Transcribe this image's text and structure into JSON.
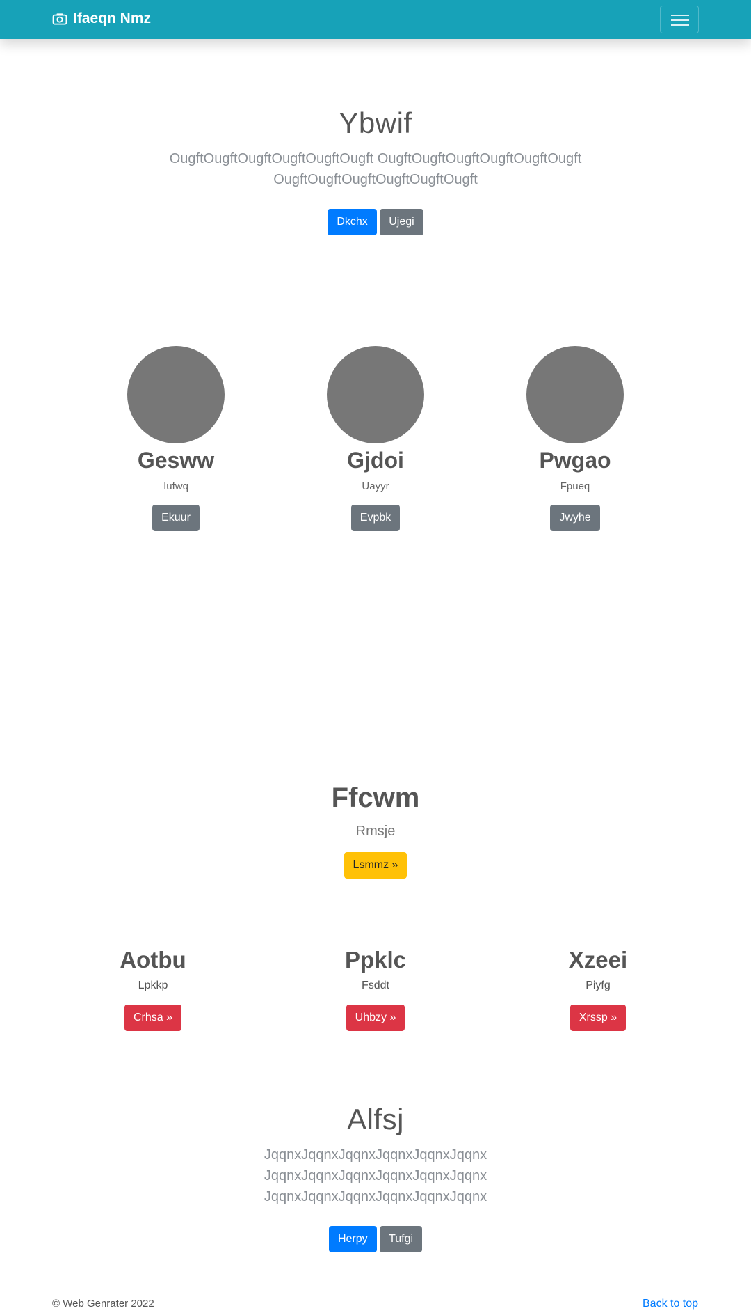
{
  "navbar": {
    "brand": "Ifaeqn Nmz",
    "camera_icon": "camera-icon",
    "toggler_icon": "hamburger-menu-icon",
    "background": "#17a2b8"
  },
  "hero": {
    "title": "Ybwif",
    "text": "OugftOugftOugftOugftOugftOugft OugftOugftOugftOugftOugftOugft OugftOugftOugftOugftOugftOugft",
    "primary_btn": "Dkchx",
    "secondary_btn": "Ujegi"
  },
  "people": [
    {
      "name": "Gesww",
      "subtitle": "Iufwq",
      "button": "Ekuur"
    },
    {
      "name": "Gjdoi",
      "subtitle": "Uayyr",
      "button": "Evpbk"
    },
    {
      "name": "Pwgao",
      "subtitle": "Fpueq",
      "button": "Jwyhe"
    }
  ],
  "feature": {
    "title": "Ffcwm",
    "subtitle": "Rmsje",
    "button": "Lsmmz »"
  },
  "columns": [
    {
      "title": "Aotbu",
      "subtitle": "Lpkkp",
      "button": "Crhsa »"
    },
    {
      "title": "Ppklc",
      "subtitle": "Fsddt",
      "button": "Uhbzy »"
    },
    {
      "title": "Xzeei",
      "subtitle": "Piyfg",
      "button": "Xrssp »"
    }
  ],
  "closing": {
    "title": "Alfsj",
    "text": "JqqnxJqqnxJqqnxJqqnxJqqnxJqqnx JqqnxJqqnxJqqnxJqqnxJqqnxJqqnx JqqnxJqqnxJqqnxJqqnxJqqnxJqqnx",
    "primary_btn": "Herpy",
    "secondary_btn": "Tufgi"
  },
  "footer": {
    "copyright": "© Web Genrater 2022",
    "back_to_top": "Back to top"
  },
  "colors": {
    "primary": "#007bff",
    "secondary": "#6c757d",
    "warning": "#ffc107",
    "danger": "#dc3545",
    "avatar": "#777777"
  }
}
